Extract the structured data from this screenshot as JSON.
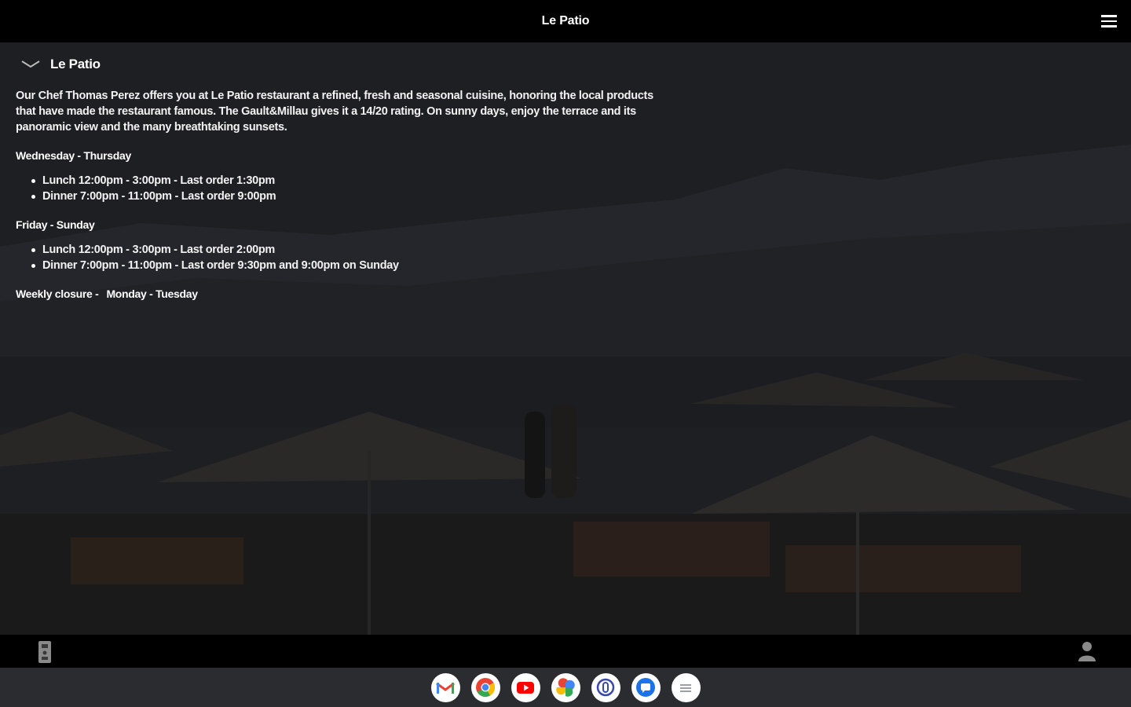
{
  "app_bar": {
    "title": "Le Patio"
  },
  "section": {
    "title": "Le Patio",
    "description": "Our Chef Thomas Perez offers you at Le Patio restaurant a refined, fresh and seasonal cuisine, honoring the local products that have made the restaurant famous. The Gault&Millau gives it a 14/20 rating. On sunny days, enjoy the terrace and its panoramic view and the many breathtaking sunsets.",
    "schedules": [
      {
        "days": "Wednesday - Thursday",
        "items": [
          "Lunch 12:00pm - 3:00pm - Last order 1:30pm",
          "Dinner 7:00pm - 11:00pm - Last order 9:00pm"
        ]
      },
      {
        "days": "Friday - Sunday",
        "items": [
          "Lunch 12:00pm - 3:00pm - Last order 2:00pm",
          "Dinner 7:00pm - 11:00pm - Last order 9:30pm and 9:00pm on Sunday"
        ]
      }
    ],
    "closure_label": "Weekly closure -",
    "closure_days": "Monday - Tuesday"
  },
  "bottom_bar": {
    "left_icon": "intercom-icon",
    "right_icon": "user-icon"
  },
  "shelf": {
    "apps": [
      "gmail-icon",
      "chrome-icon",
      "youtube-icon",
      "photos-icon",
      "app-icon",
      "messages-icon",
      "launcher-icon"
    ]
  },
  "colors": {
    "bar_background": "#000000",
    "shelf_background": "#2b2c30",
    "text": "#ffffff"
  }
}
